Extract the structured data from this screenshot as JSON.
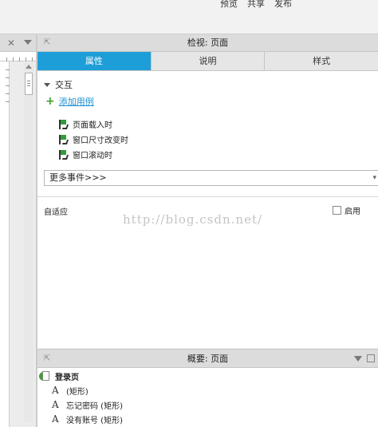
{
  "top_menu": [
    "预览",
    "共享",
    "发布"
  ],
  "inspector": {
    "title": "检视: 页面",
    "tabs": [
      {
        "label": "属性",
        "active": true
      },
      {
        "label": "说明",
        "active": false
      },
      {
        "label": "样式",
        "active": false
      }
    ],
    "interaction_heading": "交互",
    "add_case": "添加用例",
    "events": [
      "页面载入时",
      "窗口尺寸改变时",
      "窗口滚动时"
    ],
    "more_events": "更多事件>>>",
    "adaptive_label": "自适应",
    "enable_label": "启用",
    "enable_checked": false
  },
  "watermark": "http://blog.csdn.net/",
  "outline": {
    "title": "概要: 页面",
    "items": [
      {
        "icon": "page-icon",
        "label": "登录页",
        "bold": true
      },
      {
        "icon": "text-icon",
        "glyph": "A",
        "label": "(矩形)"
      },
      {
        "icon": "text-icon",
        "glyph": "A",
        "label": "忘记密码 (矩形)"
      },
      {
        "icon": "text-icon",
        "glyph": "A",
        "label": "没有账号 (矩形)"
      }
    ]
  },
  "colors": {
    "accent": "#1e9ed8",
    "link": "#1a8fd0",
    "green": "#3ea02e"
  }
}
